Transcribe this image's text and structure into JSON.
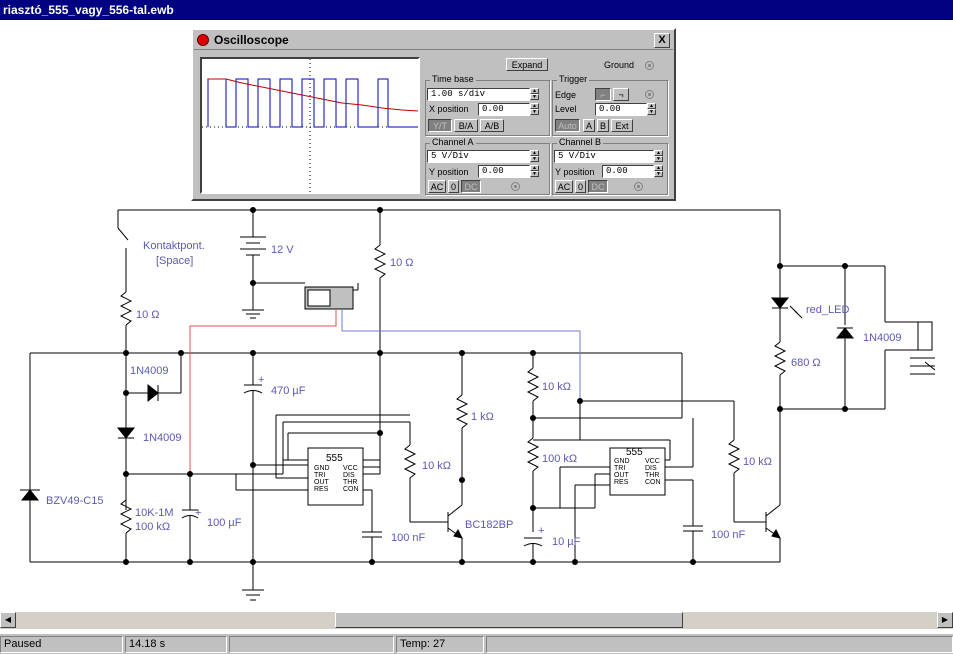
{
  "window": {
    "title": "riasztó_555_vagy_556-tal.ewb"
  },
  "oscilloscope": {
    "title": "Oscilloscope",
    "close_label": "X",
    "expand_label": "Expand",
    "ground_label": "Ground",
    "timebase": {
      "group_label": "Time base",
      "value": "1.00 s/div",
      "xpos_label": "X position",
      "xpos_value": "0.00",
      "modes": [
        "Y/T",
        "B/A",
        "A/B"
      ]
    },
    "trigger": {
      "group_label": "Trigger",
      "edge_label": "Edge",
      "level_label": "Level",
      "level_value": "0.00",
      "modes": [
        "Auto",
        "A",
        "B",
        "Ext"
      ]
    },
    "channel_a": {
      "group_label": "Channel A",
      "value": "5 V/Div",
      "ypos_label": "Y position",
      "ypos_value": "0.00",
      "coupling": [
        "AC",
        "0",
        "DC"
      ]
    },
    "channel_b": {
      "group_label": "Channel B",
      "value": "5 V/Div",
      "ypos_label": "Y position",
      "ypos_value": "0.00",
      "coupling": [
        "AC",
        "0",
        "DC"
      ]
    }
  },
  "components": {
    "switch_label_1": "Kontaktpont.",
    "switch_label_2": "[Space]",
    "battery": "12 V",
    "r_top_left": "10 Ω",
    "r_top_mid": "10 Ω",
    "diode_1": "1N4009",
    "diode_2": "1N4009",
    "cap_470": "470 µF",
    "zener": "BZV49-C15",
    "pot_1": "10K-1M",
    "pot_2": "100 kΩ",
    "cap_100u": "100 µF",
    "ic1_name": "555",
    "ic1_pins_left": [
      "GND",
      "TRI",
      "OUT",
      "RES"
    ],
    "ic1_pins_right": [
      "VCC",
      "DIS",
      "THR",
      "CON"
    ],
    "cap_100n_1": "100 nF",
    "r_1k": "1 kΩ",
    "r_10k_1": "10 kΩ",
    "transistor": "BC182BP",
    "r_10k_2": "10 kΩ",
    "r_100k": "100 kΩ",
    "cap_10u": "10 µF",
    "ic2_name": "555",
    "ic2_pins_left": [
      "GND",
      "TRI",
      "OUT",
      "RES"
    ],
    "ic2_pins_right": [
      "VCC",
      "DIS",
      "THR",
      "CON"
    ],
    "cap_100n_2": "100 nF",
    "r_10k_3": "10 kΩ",
    "led": "red_LED",
    "r_680": "680 Ω",
    "diode_3": "1N4009"
  },
  "colors": {
    "wire": "#000000",
    "probe_a": "#e05050",
    "probe_b": "#7878d8",
    "label": "#5a5ab4",
    "trace": "#0000c0",
    "trace_b": "#c00000"
  },
  "status": {
    "state": "Paused",
    "time": "14.18 s",
    "temp": "Temp:  27"
  }
}
